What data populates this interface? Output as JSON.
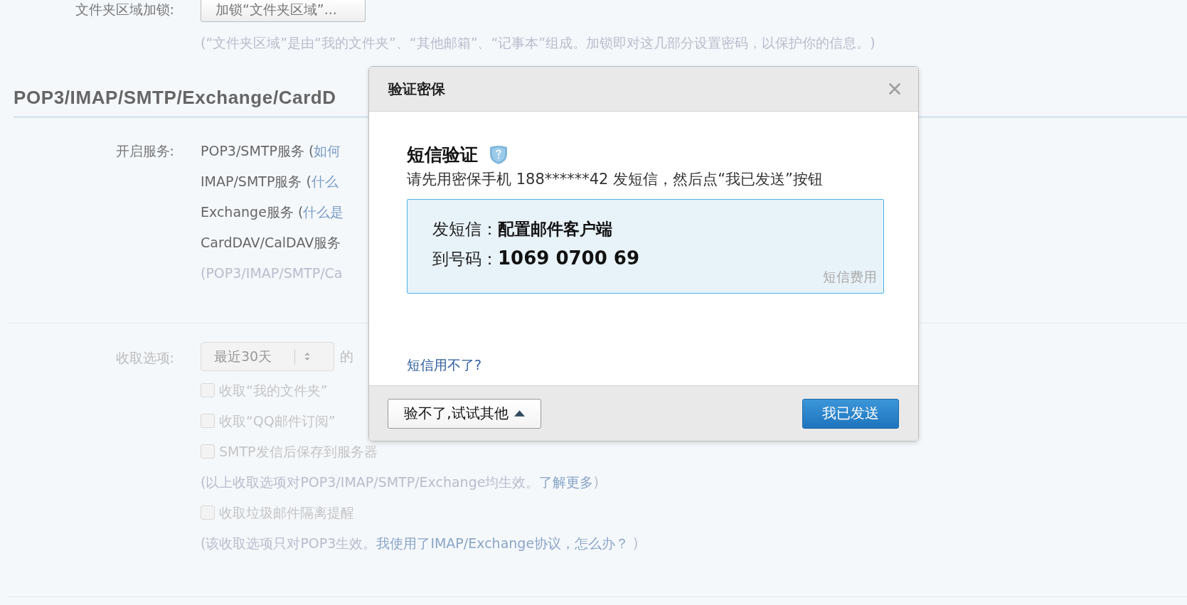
{
  "settings": {
    "folder_lock": {
      "label": "文件夹区域加锁:",
      "button": "加锁“文件夹区域”...",
      "hint": "(“文件夹区域”是由“我的文件夹”、“其他邮箱”、“记事本”组成。加锁即对这几部分设置密码，以保护你的信息。)"
    },
    "section_title": "POP3/IMAP/SMTP/Exchange/CardD",
    "services": {
      "label": "开启服务:",
      "rows": [
        {
          "segments": [
            {
              "kind": "text",
              "text": "POP3/SMTP服务 ("
            },
            {
              "kind": "link",
              "text": "如何"
            }
          ]
        },
        {
          "segments": [
            {
              "kind": "text",
              "text": "IMAP/SMTP服务 ("
            },
            {
              "kind": "link",
              "text": "什么"
            }
          ]
        },
        {
          "segments": [
            {
              "kind": "text",
              "text": "Exchange服务 ("
            },
            {
              "kind": "link",
              "text": "什么是"
            }
          ]
        },
        {
          "segments": [
            {
              "kind": "text",
              "text": "CardDAV/CalDAV服务"
            }
          ]
        }
      ],
      "note": "(POP3/IMAP/SMTP/Ca"
    },
    "receive": {
      "label": "收取选项:",
      "select": {
        "value": "最近30天",
        "disabled": true
      },
      "after_select": "的",
      "items": [
        {
          "kind": "checkbox",
          "text": "收取“我的文件夹”",
          "checked": false,
          "disabled": true
        },
        {
          "kind": "checkbox",
          "text": "收取“QQ邮件订阅”",
          "checked": false,
          "disabled": true
        },
        {
          "kind": "checkbox",
          "text": "SMTP发信后保存到服务器",
          "checked": false,
          "disabled": true
        },
        {
          "kind": "note",
          "segments": [
            {
              "kind": "text",
              "text": "(以上收取选项对POP3/IMAP/SMTP/Exchange均生效。"
            },
            {
              "kind": "link",
              "text": "了解更多"
            },
            {
              "kind": "text",
              "text": ")"
            }
          ]
        },
        {
          "kind": "checkbox",
          "text": "收取垃圾邮件隔离提醒",
          "checked": false,
          "disabled": true
        },
        {
          "kind": "note",
          "segments": [
            {
              "kind": "text",
              "text": "(该收取选项只对POP3生效。"
            },
            {
              "kind": "link",
              "text": "我使用了IMAP/Exchange协议，怎么办？"
            },
            {
              "kind": "text",
              "text": " )"
            }
          ]
        }
      ]
    }
  },
  "dialog": {
    "title": "验证密保",
    "heading": "短信验证",
    "instruction": "请先用密保手机 188******42 发短信，然后点“我已发送”按钮",
    "info": {
      "rows": [
        {
          "label": "发短信：",
          "value": "配置邮件客户端"
        },
        {
          "label": "到号码：",
          "value": "1069 0700 69"
        }
      ],
      "fee_link": "短信费用"
    },
    "help_link": "短信用不了?",
    "buttons": [
      {
        "kind": "secondary",
        "label": "验不了,试试其他"
      },
      {
        "kind": "primary",
        "label": "我已发送"
      }
    ]
  }
}
